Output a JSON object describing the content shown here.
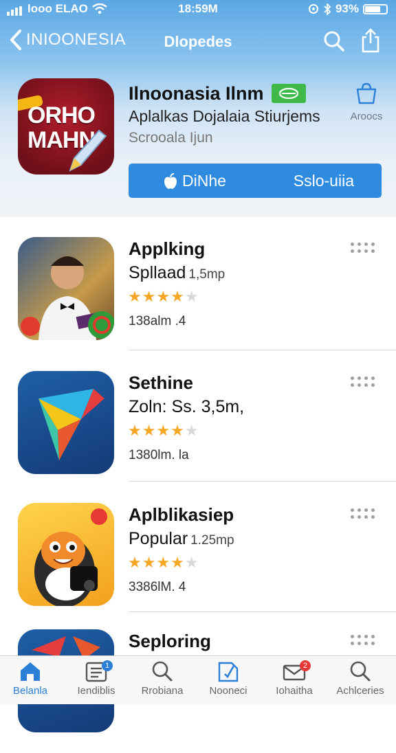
{
  "status_bar": {
    "carrier": "looo ELAO",
    "time": "18:59M",
    "battery": "93%"
  },
  "nav": {
    "back_label": "INIOONESIA",
    "title": "Dlopedes"
  },
  "featured": {
    "name": "Ilnoonasia Ilnm",
    "subtitle": "Aplalkas Dojalaia Stiurjems",
    "developer": "Scrooala Ijun",
    "icon_text": "ORHO MAHN",
    "side_button_label": "Aroocs",
    "button_left": "DiNhe",
    "button_right": "Sslo-uiia"
  },
  "apps": [
    {
      "name": "Applking",
      "subtitle": "Spllaad",
      "size": "1,5mp",
      "rating": 4,
      "count": "138alm .4"
    },
    {
      "name": "Sethine",
      "subtitle": "Zoln: Ss. 3,5m,",
      "size": "",
      "rating": 4,
      "count": "1380lm. la"
    },
    {
      "name": "Aplblikasiep",
      "subtitle": "Popular",
      "size": "1.25mp",
      "rating": 4,
      "count": "3386lM. 4"
    },
    {
      "name": "Seploring",
      "subtitle": "",
      "size": "",
      "rating": 0,
      "count": ""
    }
  ],
  "tabs": [
    {
      "label": "Belanla",
      "icon": "home-icon",
      "badge": ""
    },
    {
      "label": "Iendiblis",
      "icon": "list-icon",
      "badge": "1"
    },
    {
      "label": "Rrobiana",
      "icon": "search-icon",
      "badge": ""
    },
    {
      "label": "Nooneci",
      "icon": "news-icon",
      "badge": ""
    },
    {
      "label": "Iohaitha",
      "icon": "mail-icon",
      "badge": "2"
    },
    {
      "label": "Achlceries",
      "icon": "search-icon",
      "badge": ""
    }
  ],
  "colors": {
    "accent": "#2e8be0",
    "star": "#f5a623",
    "header_top": "#5ba7e4",
    "badge_red": "#e53935"
  }
}
